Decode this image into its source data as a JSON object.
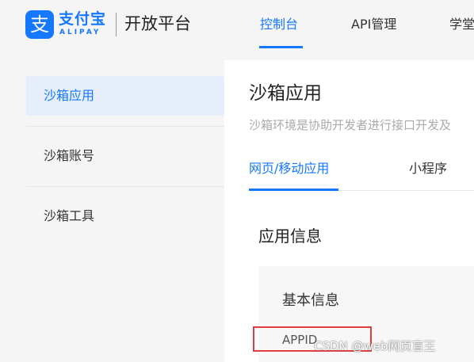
{
  "header": {
    "logo_glyph": "支",
    "brand_cn": "支付宝",
    "brand_en": "ALIPAY",
    "platform": "开放平台",
    "nav": {
      "console": "控制台",
      "api": "API管理",
      "learn": "学堂"
    }
  },
  "sidebar": {
    "items": [
      {
        "label": "沙箱应用",
        "active": true
      },
      {
        "label": "沙箱账号",
        "active": false
      },
      {
        "label": "沙箱工具",
        "active": false
      }
    ]
  },
  "main": {
    "title": "沙箱应用",
    "description": "沙箱环境是协助开发者进行接口开发及",
    "tabs": [
      {
        "label": "网页/移动应用",
        "active": true
      },
      {
        "label": "小程序",
        "active": false
      }
    ],
    "section_title": "应用信息",
    "card": {
      "title": "基本信息",
      "field_label": "APPID"
    }
  },
  "watermark": "CSDN @web网页盲王",
  "colors": {
    "accent": "#1677ff",
    "highlight": "#e23c3c",
    "active_bg": "#e6eefb"
  }
}
